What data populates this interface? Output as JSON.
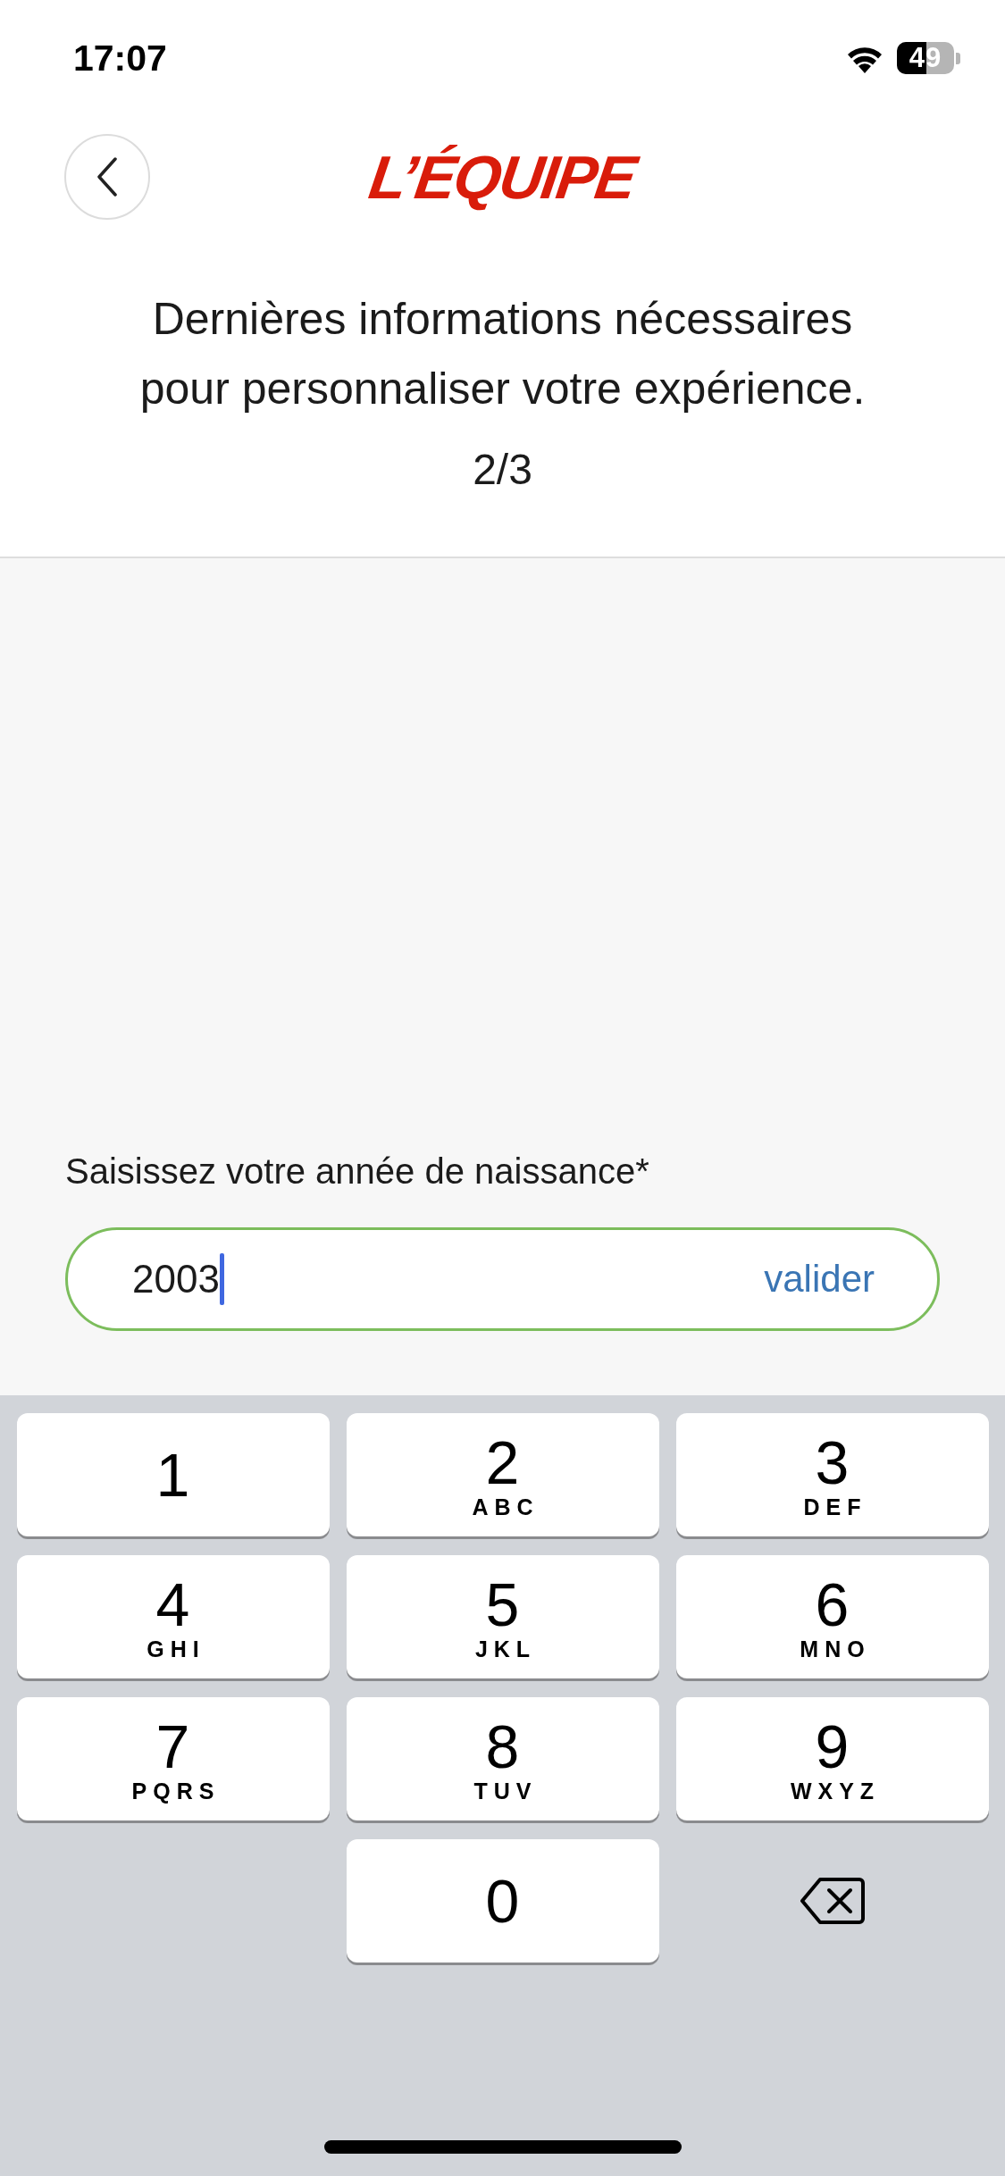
{
  "status_bar": {
    "time": "17:07",
    "battery": "49"
  },
  "header": {
    "logo": "L’ÉQUIPE"
  },
  "intro": {
    "lines": [
      "Dernières informations nécessaires",
      "pour personnaliser votre expérience."
    ],
    "step": "2/3"
  },
  "form": {
    "label": "Saisissez votre année de naissance*",
    "value": "2003",
    "focused": true,
    "submit": "valider"
  },
  "keypad": {
    "keys": [
      {
        "kind": "digit",
        "digit": "1"
      },
      {
        "kind": "digit",
        "digit": "2",
        "letters": "ABC"
      },
      {
        "kind": "digit",
        "digit": "3",
        "letters": "DEF"
      },
      {
        "kind": "digit",
        "digit": "4",
        "letters": "GHI"
      },
      {
        "kind": "digit",
        "digit": "5",
        "letters": "JKL"
      },
      {
        "kind": "digit",
        "digit": "6",
        "letters": "MNO"
      },
      {
        "kind": "digit",
        "digit": "7",
        "letters": "PQRS"
      },
      {
        "kind": "digit",
        "digit": "8",
        "letters": "TUV"
      },
      {
        "kind": "digit",
        "digit": "9",
        "letters": "WXYZ"
      },
      {
        "kind": "empty"
      },
      {
        "kind": "digit",
        "digit": "0"
      },
      {
        "kind": "delete"
      }
    ]
  }
}
